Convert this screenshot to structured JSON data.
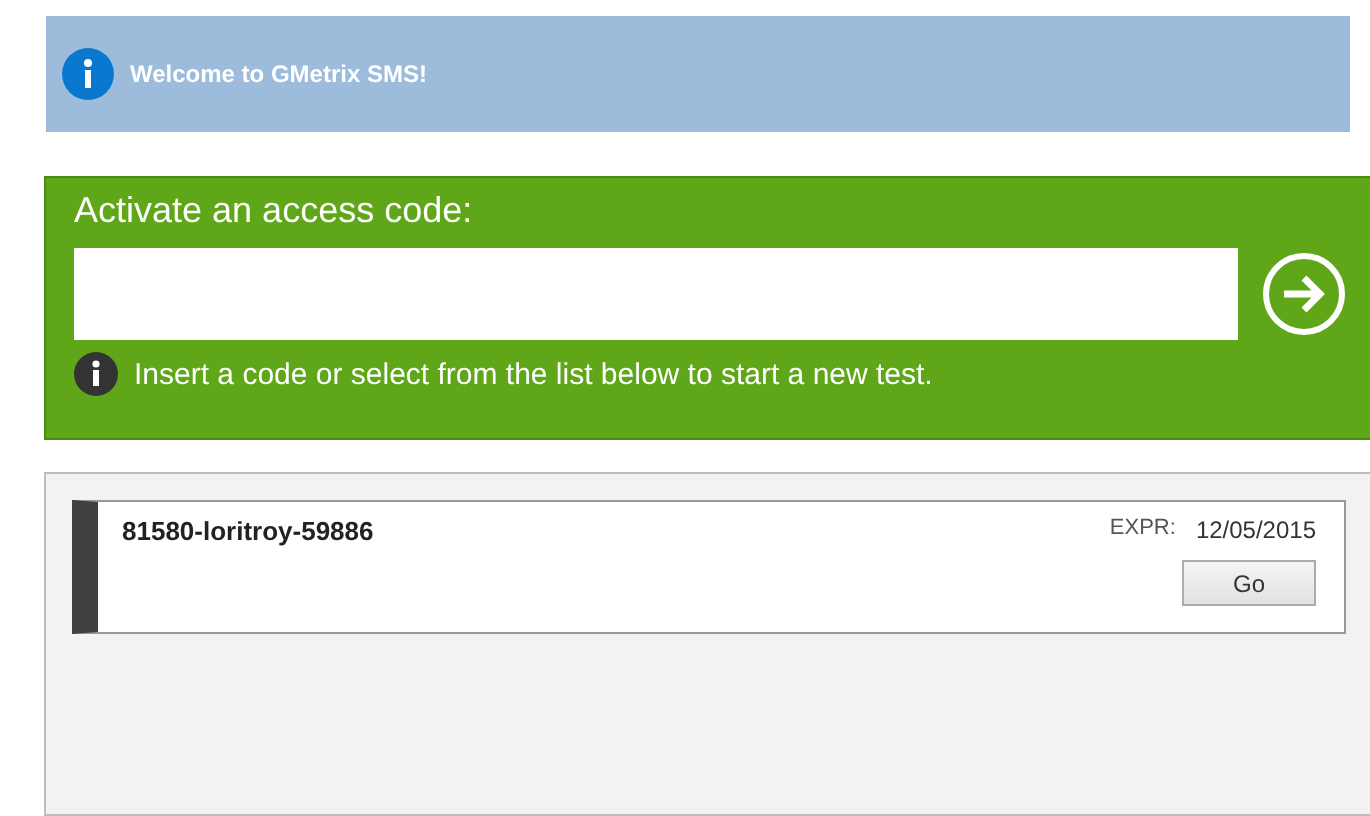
{
  "banner": {
    "text": "Welcome to GMetrix SMS!"
  },
  "activate": {
    "title": "Activate an access code:",
    "hint": "Insert a code or select from the list below to start a new test."
  },
  "codes": [
    {
      "code": "81580-loritroy-59886",
      "expr_label": "EXPR:",
      "expr_date": "12/05/2015",
      "button": "Go"
    }
  ]
}
